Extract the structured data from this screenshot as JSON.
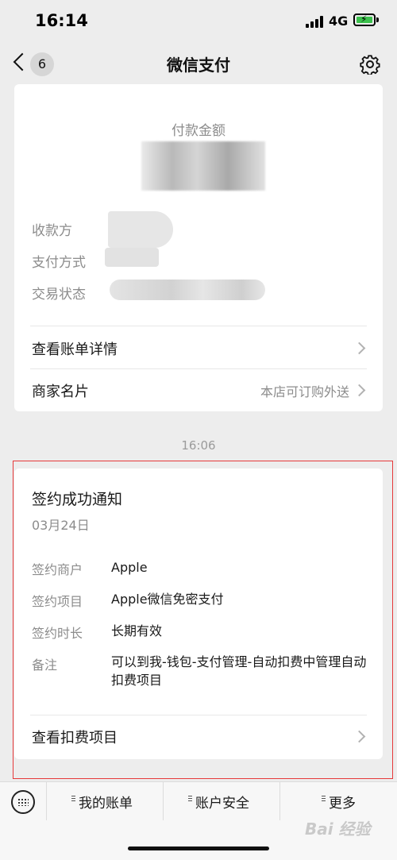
{
  "status_bar": {
    "time": "16:14",
    "network": "4G"
  },
  "nav": {
    "back_count": "6",
    "title": "微信支付"
  },
  "payment_card": {
    "amount_label": "付款金额",
    "payee_label": "收款方",
    "method_label": "支付方式",
    "status_label": "交易状态",
    "bill_detail_label": "查看账单详情",
    "merchant_card_label": "商家名片",
    "merchant_card_value": "本店可订购外送"
  },
  "timestamp": "16:06",
  "notice_card": {
    "title": "签约成功通知",
    "date": "03月24日",
    "fields": [
      {
        "label": "签约商户",
        "value": "Apple"
      },
      {
        "label": "签约项目",
        "value": "Apple微信免密支付"
      },
      {
        "label": "签约时长",
        "value": "长期有效"
      },
      {
        "label": "备注",
        "value": "可以到我-钱包-支付管理-自动扣费中管理自动扣费项目"
      }
    ],
    "action_label": "查看扣费项目"
  },
  "bottom_menu": {
    "items": [
      "我的账单",
      "账户安全",
      "更多"
    ]
  },
  "watermark": "Bai 经验",
  "colors": {
    "highlight": "#e6393a",
    "battery": "#3cc14d",
    "background": "#ededed"
  }
}
